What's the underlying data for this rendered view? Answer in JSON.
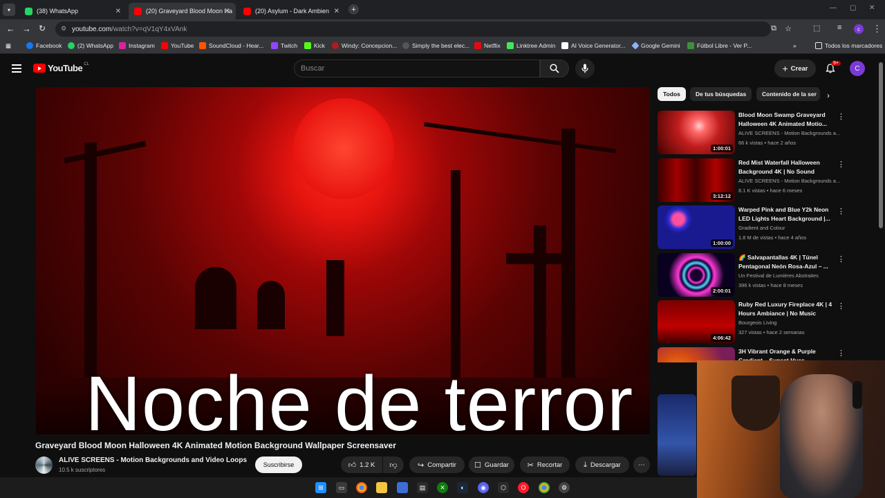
{
  "browser": {
    "tabs": [
      {
        "title": "(38) WhatsApp",
        "active": false,
        "color": "#25d366"
      },
      {
        "title": "(20) Graveyard Blood Moon Ha",
        "active": true,
        "color": "#ff0000"
      },
      {
        "title": "(20) Asylum - Dark Ambien",
        "active": false,
        "color": "#ff0000"
      }
    ],
    "url_host": "youtube.com",
    "url_path": "/watch?v=qV1qY4xVAnk",
    "bookmarks": [
      "Facebook",
      "(2) WhatsApp",
      "Instagram",
      "YouTube",
      "SoundCloud - Hear...",
      "Twitch",
      "Kick",
      "Windy: Concepcion...",
      "Simply the best elec...",
      "Netflix",
      "Linktree Admin",
      "AI Voice Generator...",
      "Google Gemini",
      "Fútbol Libre - Ver P..."
    ],
    "all_bookmarks": "Todos los marcadores"
  },
  "header": {
    "logo_text": "YouTube",
    "country": "CL",
    "search_placeholder": "Buscar",
    "create_label": "Crear",
    "notifications_badge": "9+",
    "avatar_letter": "C"
  },
  "video": {
    "subtitle_overlay": "Noche de terror",
    "title": "Graveyard Blood Moon Halloween 4K Animated Motion Background Wallpaper Screensaver",
    "channel": "ALIVE SCREENS - Motion Backgrounds and Video Loops",
    "subscribers": "10.5 k suscriptores",
    "subscribe_label": "Suscribirse",
    "likes": "1.2 K",
    "share_label": "Compartir",
    "save_label": "Guardar",
    "clip_label": "Recortar",
    "download_label": "Descargar"
  },
  "sidebar": {
    "chips": [
      "Todos",
      "De tus búsquedas",
      "Contenido de la ser"
    ],
    "recommendations": [
      {
        "title": "Blood Moon Swamp Graveyard Halloween 4K Animated Motio...",
        "channel": "ALIVE SCREENS - Motion Backgrounds a...",
        "meta": "66 k vistas • hace 2 años",
        "duration": "1:00:01"
      },
      {
        "title": "Red Mist Waterfall Halloween Background 4K | No Sound",
        "channel": "ALIVE SCREENS - Motion Backgrounds a...",
        "meta": "8.1 K vistas • hace 6 meses",
        "duration": "3:12:12"
      },
      {
        "title": "Warped Pink and Blue Y2k Neon LED Lights Heart Background |...",
        "channel": "Gradient and Colour",
        "meta": "1.8 M de vistas • hace 4 años",
        "duration": "1:00:00"
      },
      {
        "title": "🌈 Salvapantallas 4K | Túnel Pentagonal Neón Rosa-Azul – ...",
        "channel": "Un Festival de Lumières Abstraites",
        "meta": "396 k vistas • hace 8 meses",
        "duration": "2:00:01"
      },
      {
        "title": "Ruby Red Luxury Fireplace 4K | 4 Hours Ambiance | No Music",
        "channel": "Bourgeois Living",
        "meta": "327 vistas • hace 2 semanas",
        "duration": "4:06:42"
      },
      {
        "title": "3H Vibrant Orange & Purple Gradient – Sunset Hues –",
        "channel": "",
        "meta": "",
        "duration": ""
      }
    ]
  },
  "colors": {
    "background": "#0f0f0f",
    "accent": "#ff0000"
  }
}
